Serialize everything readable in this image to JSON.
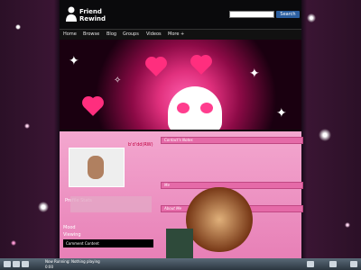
{
  "app": {
    "logo_line1": "Friend",
    "logo_line2": "Rewind"
  },
  "search": {
    "placeholder": "",
    "button_label": "Search"
  },
  "nav": {
    "items": [
      "Home",
      "Browse",
      "Blog",
      "Groups",
      "Videos",
      "More +"
    ]
  },
  "profile": {
    "username": "b'd'dd(RW)",
    "left_labels": [
      "Profile Stats",
      "Mood",
      "Viewing"
    ],
    "black_bar_label": "Comment Content"
  },
  "right_panels": [
    "Contact's Notes",
    "Me",
    "About Me"
  ],
  "taskbar": {
    "track_line1": "Now Running: Nothing playing",
    "track_line2": "0:00"
  }
}
